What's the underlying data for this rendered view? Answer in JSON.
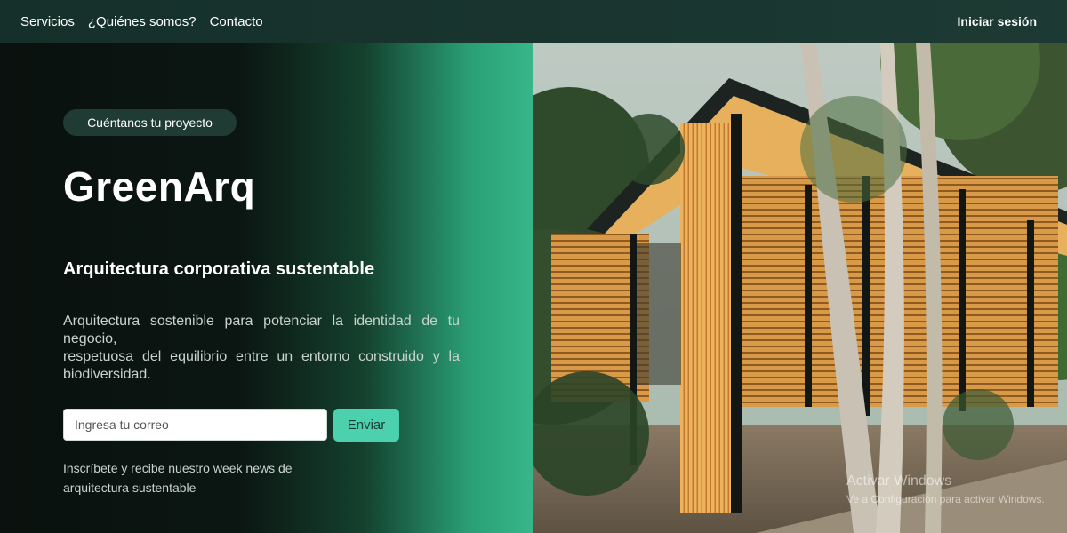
{
  "nav": {
    "links": [
      "Servicios",
      "¿Quiénes somos?",
      "Contacto"
    ],
    "login_label": "Iniciar sesión"
  },
  "hero": {
    "pill_label": "Cuéntanos tu proyecto",
    "brand": "GreenArq",
    "subtitle": "Arquitectura corporativa sustentable",
    "description_lines": [
      "Arquitectura sostenible para potenciar la identidad de tu negocio,",
      "respetuosa del equilibrio entre un entorno construido y la biodiversidad."
    ],
    "email_placeholder": "Ingresa tu correo",
    "email_value": "",
    "send_label": "Enviar",
    "note_lines": [
      "Inscríbete y recibe nuestro week news de",
      "arquitectura sustentable"
    ]
  },
  "watermark": {
    "title": "Activar Windows",
    "subtitle": "Ve a Configuración para activar Windows."
  },
  "colors": {
    "accent": "#4bd1ad",
    "navbar": "#1a3530",
    "pill": "#1f3b34"
  }
}
